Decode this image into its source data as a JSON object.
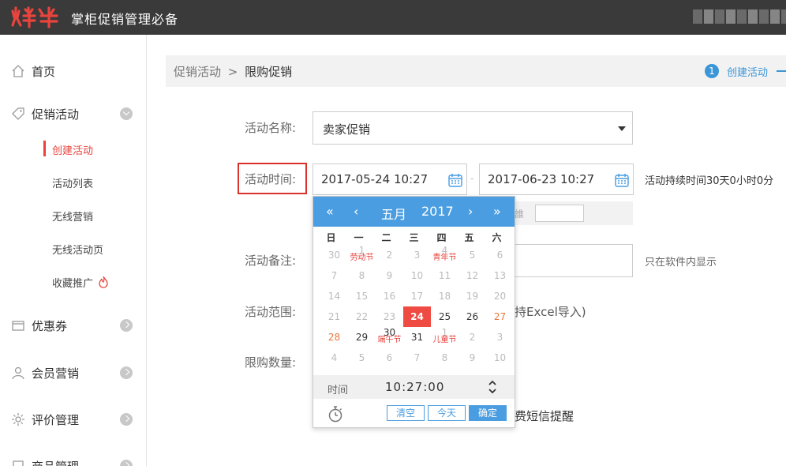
{
  "header": {
    "logo_text": "火牛",
    "app_title": "掌柜促销管理必备"
  },
  "sidebar": {
    "items": [
      {
        "label": "首页",
        "icon": "home-icon"
      },
      {
        "label": "促销活动",
        "icon": "tag-icon"
      },
      {
        "label": "优惠券",
        "icon": "wallet-icon"
      },
      {
        "label": "会员营销",
        "icon": "user-icon"
      },
      {
        "label": "评价管理",
        "icon": "gear-icon"
      },
      {
        "label": "商品管理",
        "icon": "box-icon"
      }
    ],
    "subitems": [
      "创建活动",
      "活动列表",
      "无线营销",
      "无线活动页",
      "收藏推广"
    ]
  },
  "breadcrumb": {
    "parent": "促销活动",
    "separator": ">",
    "current": "限购促销"
  },
  "steps": {
    "number": "1",
    "label": "创建活动"
  },
  "form": {
    "name_label": "活动名称:",
    "name_value": "卖家促销",
    "time_label": "活动时间:",
    "start_time": "2017-05-24 10:27",
    "time_separator": "-",
    "end_time": "2017-06-23 10:27",
    "duration": "活动持续时间30天0小时0分",
    "strip_fragment": "誰",
    "remark_label": "活动备注:",
    "remark_hint": "只在软件内显示",
    "range_label": "活动范围:",
    "range_fragment": "持Excel导入)",
    "limit_label": "限购数量:",
    "sms_fragment": "费短信提醒"
  },
  "calendar": {
    "nav": {
      "prev_year": "«",
      "prev_month": "‹",
      "month": "五月",
      "year": "2017",
      "next_month": "›",
      "next_year": "»"
    },
    "weekdays": [
      "日",
      "一",
      "二",
      "三",
      "四",
      "五",
      "六"
    ],
    "weeks": [
      [
        {
          "d": "30",
          "s": "out"
        },
        {
          "d": "1",
          "s": "out",
          "f": "劳动节"
        },
        {
          "d": "2",
          "s": "out"
        },
        {
          "d": "3",
          "s": "out"
        },
        {
          "d": "4",
          "s": "out",
          "f": "青年节"
        },
        {
          "d": "5",
          "s": "out"
        },
        {
          "d": "6",
          "s": "out"
        }
      ],
      [
        {
          "d": "7",
          "s": "out"
        },
        {
          "d": "8",
          "s": "out"
        },
        {
          "d": "9",
          "s": "out"
        },
        {
          "d": "10",
          "s": "out"
        },
        {
          "d": "11",
          "s": "out"
        },
        {
          "d": "12",
          "s": "out"
        },
        {
          "d": "13",
          "s": "out"
        }
      ],
      [
        {
          "d": "14",
          "s": "out"
        },
        {
          "d": "15",
          "s": "out"
        },
        {
          "d": "16",
          "s": "out"
        },
        {
          "d": "17",
          "s": "out"
        },
        {
          "d": "18",
          "s": "out"
        },
        {
          "d": "19",
          "s": "out"
        },
        {
          "d": "20",
          "s": "out"
        }
      ],
      [
        {
          "d": "21",
          "s": "out"
        },
        {
          "d": "22",
          "s": "out"
        },
        {
          "d": "23",
          "s": "out"
        },
        {
          "d": "24",
          "s": "selected"
        },
        {
          "d": "25",
          "s": "normal"
        },
        {
          "d": "26",
          "s": "normal"
        },
        {
          "d": "27",
          "s": "weekend"
        }
      ],
      [
        {
          "d": "28",
          "s": "weekend"
        },
        {
          "d": "29",
          "s": "normal"
        },
        {
          "d": "30",
          "s": "normal",
          "f": "端午节"
        },
        {
          "d": "31",
          "s": "normal"
        },
        {
          "d": "1",
          "s": "out",
          "f": "儿童节"
        },
        {
          "d": "2",
          "s": "out"
        },
        {
          "d": "3",
          "s": "out"
        }
      ],
      [
        {
          "d": "4",
          "s": "out"
        },
        {
          "d": "5",
          "s": "out"
        },
        {
          "d": "6",
          "s": "out"
        },
        {
          "d": "7",
          "s": "out"
        },
        {
          "d": "8",
          "s": "out"
        },
        {
          "d": "9",
          "s": "out"
        },
        {
          "d": "10",
          "s": "out"
        }
      ]
    ],
    "time_label": "时间",
    "time_value": "10:27:00",
    "clear": "清空",
    "today": "今天",
    "confirm": "确定"
  },
  "colors": {
    "accent": "#e8433d",
    "calendar_blue": "#4a9de0",
    "header_bg": "#3a3a3a"
  }
}
